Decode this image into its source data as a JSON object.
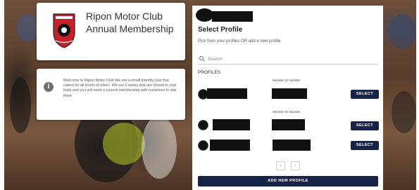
{
  "club": {
    "title": "Ripon Motor Club Annual Membership",
    "logo_icon": "club-crest-icon",
    "logo_color": "#c8202a"
  },
  "info": {
    "icon": "info-icon",
    "text": "Welcome to Ripon Motor Club We are a small friendly club that caters for all levels of riders. We run 2 series that are closed to club trials and you will need a current membership with ourselves to ride them."
  },
  "panel": {
    "heading": "Select Profile",
    "subheading": "Pick from your profiles OR add a new profile.",
    "search_placeholder": "Search",
    "profiles_label": "PROFILES",
    "member_id_label": "Member ID Number",
    "select_label": "SELECT",
    "prev_label": "‹",
    "next_label": "›",
    "add_label": "ADD NEW PROFILE",
    "accent_color": "#182447"
  }
}
